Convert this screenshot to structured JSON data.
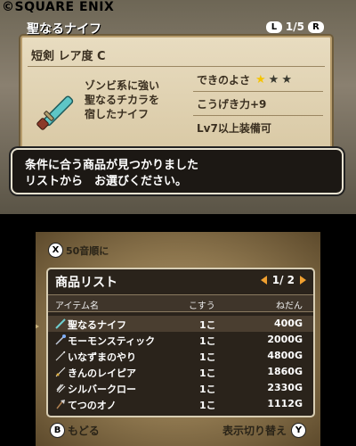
{
  "copyright": "©SQUARE ENIX",
  "item_detail": {
    "name": "聖なるナイフ",
    "page": "1/5",
    "page_left_button": "L",
    "page_right_button": "R",
    "category_line": "短剣  レア度 C",
    "description": [
      "ゾンビ系に強い",
      "聖なるチカラを",
      "宿したナイフ"
    ],
    "quality_label": "できのよさ",
    "quality_stars": {
      "filled": 1,
      "total": 3
    },
    "attack": "こうげき力+9",
    "requirement": "Lv7以上装備可",
    "weapon_icon": "knife-icon"
  },
  "message": [
    "条件に合う商品が見つかりました",
    "リストから　お選びください。"
  ],
  "shop": {
    "sort_button": "X",
    "sort_label": "50音順に",
    "list_title": "商品リスト",
    "page": "1/ 2",
    "columns": {
      "item": "アイテム名",
      "qty": "こすう",
      "price": "ねだん"
    },
    "rows": [
      {
        "name": "聖なるナイフ",
        "qty": "1こ",
        "price": "400G",
        "icon": "knife-icon",
        "selected": true
      },
      {
        "name": "モーモンスティック",
        "qty": "1こ",
        "price": "2000G",
        "icon": "staff-icon"
      },
      {
        "name": "いなずまのやり",
        "qty": "1こ",
        "price": "4800G",
        "icon": "spear-icon"
      },
      {
        "name": "きんのレイピア",
        "qty": "1こ",
        "price": "1860G",
        "icon": "rapier-icon"
      },
      {
        "name": "シルバークロー",
        "qty": "1こ",
        "price": "2330G",
        "icon": "claw-icon"
      },
      {
        "name": "てつのオノ",
        "qty": "1こ",
        "price": "1112G",
        "icon": "axe-icon"
      }
    ],
    "back_button": "B",
    "back_label": "もどる",
    "toggle_label": "表示切り替え",
    "toggle_button": "Y"
  },
  "colors": {
    "parchment": "#e0d2b2",
    "accent_arrow": "#f0a030",
    "star_gold": "#f5c400",
    "star_dark": "#3a3a30"
  }
}
